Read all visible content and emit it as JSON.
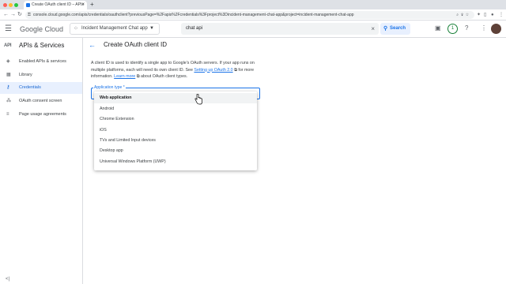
{
  "browser": {
    "tab_title": "Create OAuth client ID – APIs",
    "new_tab": "+",
    "url": "console.cloud.google.com/apis/credentials/oauthclient?previousPage=%2Fapis%2Fcredentials%3Fproject%3Dincident-management-chat-app&project=incident-management-chat-app"
  },
  "header": {
    "logo_google": "Google",
    "logo_cloud": "Cloud",
    "project_name": "Incident Management Chat app",
    "search_value": "chat api",
    "search_button": "Search",
    "notification_count": "1"
  },
  "sidebar": {
    "api_badge": "API",
    "title": "APIs & Services",
    "items": [
      {
        "label": "Enabled APIs & services",
        "icon": "diamond-icon"
      },
      {
        "label": "Library",
        "icon": "library-icon"
      },
      {
        "label": "Credentials",
        "icon": "key-icon"
      },
      {
        "label": "OAuth consent screen",
        "icon": "consent-icon"
      },
      {
        "label": "Page usage agreements",
        "icon": "agreements-icon"
      }
    ],
    "collapse": "<|"
  },
  "main": {
    "title": "Create OAuth client ID",
    "desc_part1": "A client ID is used to identify a single app to Google's OAuth servers. If your app runs on multiple platforms, each will need its own client ID. See ",
    "desc_link1": "Setting up OAuth 2.0",
    "desc_part2": " for more information. ",
    "desc_link2": "Learn more",
    "desc_part3": " about OAuth client types.",
    "field_label": "Application type *",
    "options": [
      "Web application",
      "Android",
      "Chrome Extension",
      "iOS",
      "TVs and Limited Input devices",
      "Desktop app",
      "Universal Windows Platform (UWP)"
    ],
    "selected_option": "Web application"
  },
  "colors": {
    "accent": "#1a73e8",
    "active_bg": "#e8f0fe"
  }
}
